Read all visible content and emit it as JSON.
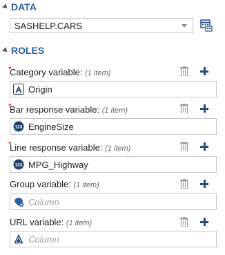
{
  "data_section": {
    "title": "DATA",
    "dataset_value": "SASHELP.CARS"
  },
  "roles_section": {
    "title": "ROLES",
    "roles": [
      {
        "label": "Category variable:",
        "count": "(1 item)",
        "required": true,
        "value": "Origin",
        "value_icon": "character-variable-icon",
        "placeholder": ""
      },
      {
        "label": "Bar response variable:",
        "count": "(1 item)",
        "required": true,
        "value": "EngineSize",
        "value_icon": "numeric-variable-icon",
        "placeholder": ""
      },
      {
        "label": "Line response variable:",
        "count": "(1 item)",
        "required": true,
        "value": "MPG_Highway",
        "value_icon": "numeric-variable-icon",
        "placeholder": ""
      },
      {
        "label": "Group variable:",
        "count": "(1 item)",
        "required": false,
        "value": "",
        "value_icon": "column-icon",
        "placeholder": "Column"
      },
      {
        "label": "URL variable:",
        "count": "(1 item)",
        "required": false,
        "value": "",
        "value_icon": "character-variable-icon",
        "placeholder": "Column"
      }
    ]
  },
  "colors": {
    "accent": "#2a5ea8",
    "required": "#d0021b",
    "numeric_icon": "#1f3f6e"
  }
}
